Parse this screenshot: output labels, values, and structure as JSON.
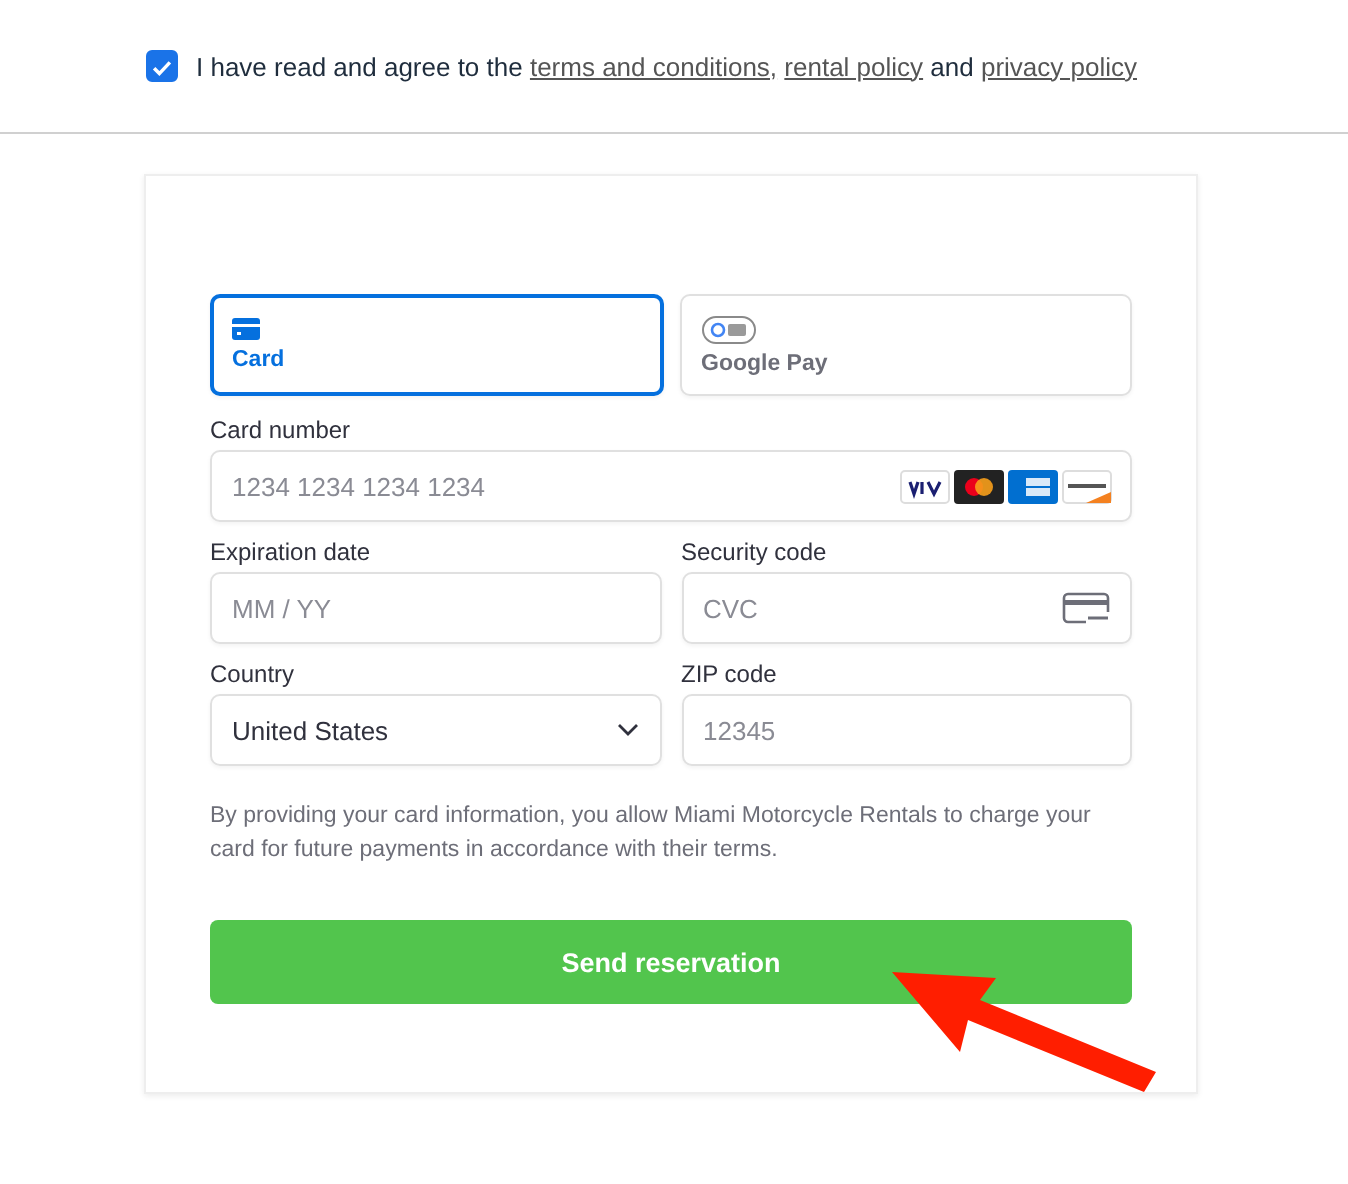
{
  "consent": {
    "checked": true,
    "segments": [
      {
        "kind": "text",
        "text": "I have read and agree to the "
      },
      {
        "kind": "link",
        "text": "terms and conditions,"
      },
      {
        "kind": "link",
        "text": "rental policy"
      },
      {
        "kind": "text",
        "text": " and "
      },
      {
        "kind": "link",
        "text": "privacy policy"
      }
    ]
  },
  "payment_methods": [
    {
      "kind": "card",
      "label": "Card",
      "selected": true
    },
    {
      "kind": "gpay",
      "label": "Google Pay",
      "selected": false
    }
  ],
  "fields": [
    {
      "kind": "card-number",
      "label": "Card number",
      "placeholder": "1234 1234 1234 1234"
    },
    {
      "kind": "text",
      "label": "Expiration date",
      "placeholder": "MM / YY"
    },
    {
      "kind": "cvc",
      "label": "Security code",
      "placeholder": "CVC"
    },
    {
      "kind": "select",
      "label": "Country",
      "value": "United States"
    },
    {
      "kind": "text",
      "label": "ZIP code",
      "placeholder": "12345"
    }
  ],
  "notice": "By providing your card information, you allow Miami Motorcycle Rentals to charge your card for future payments in accordance with their terms.",
  "submit_button": "Send reservation"
}
